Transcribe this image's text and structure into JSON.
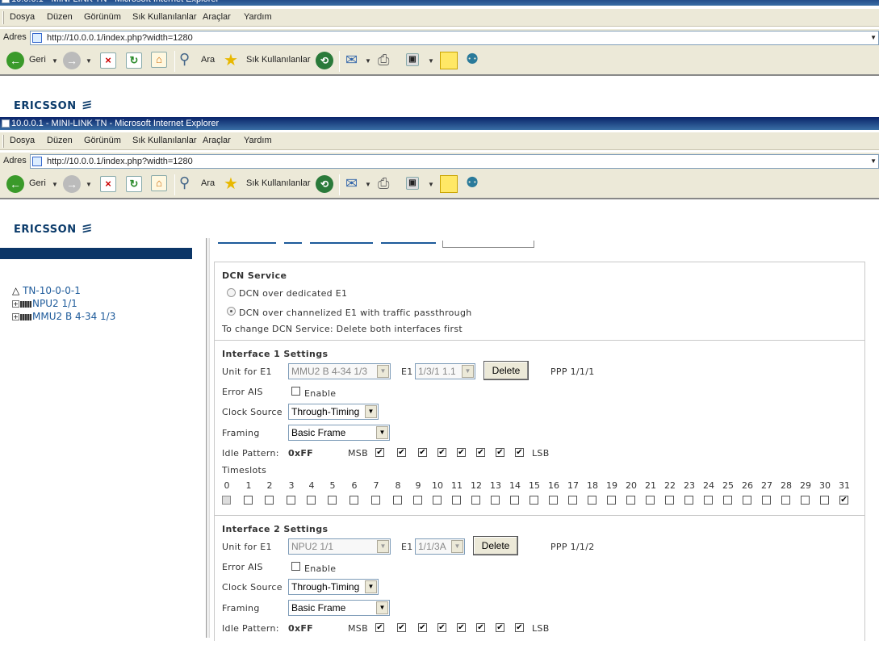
{
  "browser": {
    "window_title": "10.0.0.1 - MINI-LINK TN - Microsoft Internet Explorer",
    "menu": [
      "Dosya",
      "Düzen",
      "Görünüm",
      "Sık Kullanılanlar",
      "Araçlar",
      "Yardım"
    ],
    "address_label": "Adres",
    "url": "http://10.0.0.1/index.php?width=1280",
    "back_label": "Geri",
    "search_label": "Ara",
    "favorites_label": "Sık Kullanılanlar"
  },
  "logo": {
    "text": "ERICSSON"
  },
  "tree": {
    "root": "TN-10-0-0-1",
    "items": [
      "NPU2 1/1",
      "MMU2 B 4-34 1/3"
    ]
  },
  "dcn": {
    "title": "DCN Service",
    "option1": "DCN over dedicated E1",
    "option2": "DCN over channelized E1 with traffic passthrough",
    "note": "To change DCN Service: Delete both interfaces first"
  },
  "interface1": {
    "title": "Interface 1 Settings",
    "unit_label": "Unit for E1",
    "unit_value": "MMU2 B 4-34 1/3",
    "e1_label": "E1",
    "e1_value": "1/3/1 1.1",
    "delete_label": "Delete",
    "ppp": "PPP 1/1/1",
    "error_ais_label": "Error AIS",
    "enable_label": "Enable",
    "clock_label": "Clock Source",
    "clock_value": "Through-Timing",
    "framing_label": "Framing",
    "framing_value": "Basic Frame",
    "idle_label": "Idle Pattern:",
    "idle_value": "0xFF",
    "msb": "MSB",
    "lsb": "LSB",
    "timeslots_label": "Timeslots"
  },
  "interface2": {
    "title": "Interface 2 Settings",
    "unit_label": "Unit for E1",
    "unit_value": "NPU2 1/1",
    "e1_label": "E1",
    "e1_value": "1/1/3A",
    "delete_label": "Delete",
    "ppp": "PPP 1/1/2",
    "error_ais_label": "Error AIS",
    "enable_label": "Enable",
    "clock_label": "Clock Source",
    "clock_value": "Through-Timing",
    "framing_label": "Framing",
    "framing_value": "Basic Frame",
    "idle_label": "Idle Pattern:",
    "idle_value": "0xFF",
    "msb": "MSB",
    "lsb": "LSB"
  },
  "timeslots": [
    "0",
    "1",
    "2",
    "3",
    "4",
    "5",
    "6",
    "7",
    "8",
    "9",
    "10",
    "11",
    "12",
    "13",
    "14",
    "15",
    "16",
    "17",
    "18",
    "19",
    "20",
    "21",
    "22",
    "23",
    "24",
    "25",
    "26",
    "27",
    "28",
    "29",
    "30",
    "31"
  ],
  "timeslot_checked": [
    31
  ],
  "timeslot_disabled": [
    0
  ]
}
